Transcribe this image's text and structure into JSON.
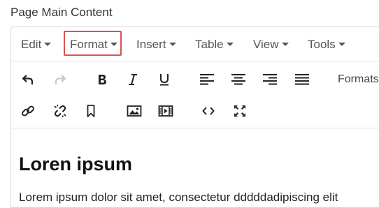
{
  "field_label": "Page Main Content",
  "menubar": {
    "items": [
      "Edit",
      "Format",
      "Insert",
      "Table",
      "View",
      "Tools"
    ],
    "highlighted_item": "Format",
    "highlight_color": "#d9534f"
  },
  "toolbar": {
    "row1": [
      "undo-icon",
      "redo-icon",
      "bold-icon",
      "italic-icon",
      "underline-icon",
      "align-left-icon",
      "align-center-icon",
      "align-right-icon",
      "align-justify-icon"
    ],
    "formats_label": "Formats",
    "row2": [
      "link-icon",
      "unlink-icon",
      "bookmark-icon",
      "image-icon",
      "media-icon",
      "code-icon",
      "fullscreen-icon"
    ]
  },
  "content": {
    "heading": "Loren ipsum",
    "paragraph": "Lorem ipsum dolor sit amet, consectetur dddddadipiscing elit"
  }
}
